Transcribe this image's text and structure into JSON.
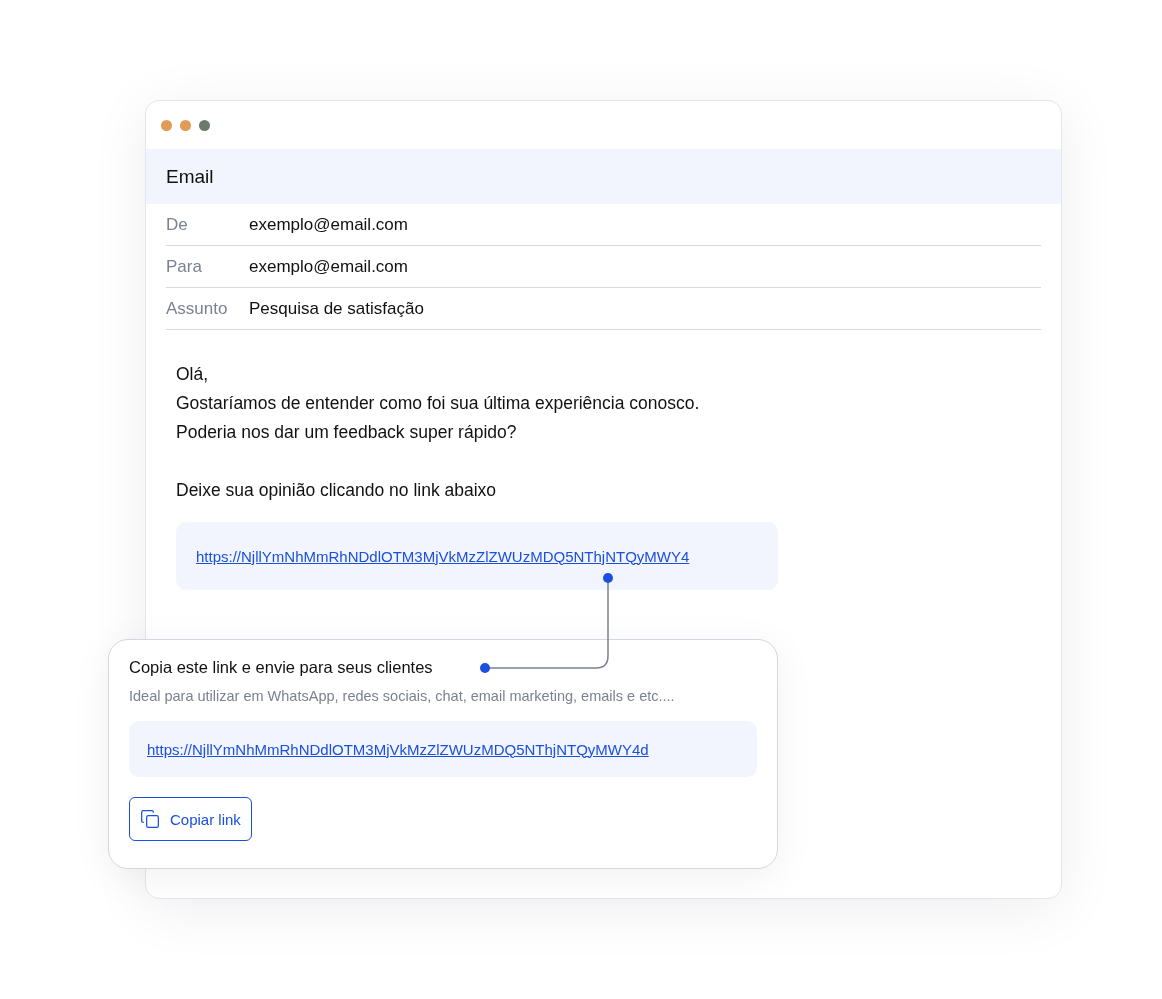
{
  "window": {
    "title": "Email",
    "controls": [
      {
        "color": "#e29a56"
      },
      {
        "color": "#e29a56"
      },
      {
        "color": "#6b7a6b"
      }
    ]
  },
  "fields": [
    {
      "label": "De",
      "value": "exemplo@email.com"
    },
    {
      "label": "Para",
      "value": "exemplo@email.com"
    },
    {
      "label": "Assunto",
      "value": "Pesquisa de satisfação"
    }
  ],
  "body": {
    "paragraphs": [
      [
        "Olá,",
        "Gostaríamos de entender como foi sua última experiência conosco.",
        "Poderia nos dar um feedback super rápido?"
      ],
      [
        "Deixe sua opinião clicando no link abaixo"
      ]
    ],
    "link": "https://NjllYmNhMmRhNDdlOTM3MjVkMzZlZWUzMDQ5NThjNTQyMWY4"
  },
  "share_card": {
    "title": "Copia este link e envie para seus clientes",
    "subtitle": "Ideal para utilizar em WhatsApp, redes sociais, chat, email marketing, emails e etc....",
    "link": "https://NjllYmNhMmRhNDdlOTM3MjVkMzZlZWUzMDQ5NThjNTQyMWY4d",
    "button": "Copiar link"
  }
}
